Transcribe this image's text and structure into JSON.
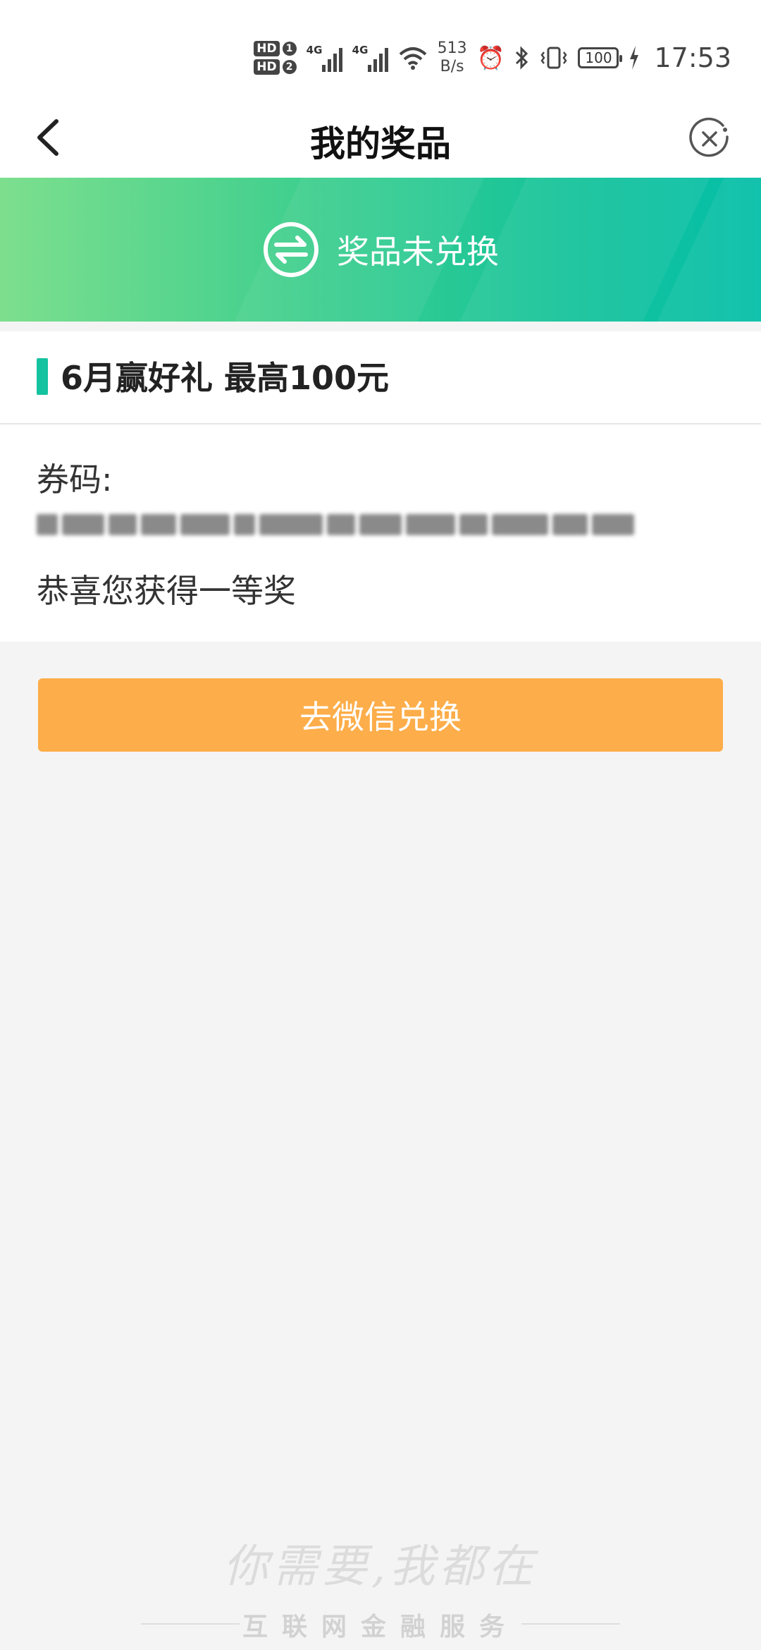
{
  "status_bar": {
    "sim1": "HD",
    "sim1_num": "1",
    "sim2": "HD",
    "sim2_num": "2",
    "net1": "4G",
    "net2": "4G",
    "speed_value": "513",
    "speed_unit": "B/s",
    "battery": "100",
    "time": "17:53",
    "icons": [
      "alarm-icon",
      "bluetooth-icon",
      "vibrate-icon",
      "charging-icon"
    ]
  },
  "header": {
    "title": "我的奖品",
    "back_icon": "back-arrow-icon",
    "close_icon": "close-circle-icon"
  },
  "banner": {
    "status_text": "奖品未兑换",
    "icon": "exchange-icon",
    "colors": [
      "#7ddf8e",
      "#05bfa8"
    ]
  },
  "prize": {
    "title": "6月赢好礼 最高100元",
    "code_label": "券码:",
    "message": "恭喜您获得一等奖"
  },
  "action": {
    "redeem_label": "去微信兑换",
    "color": "#fdad49"
  },
  "footer": {
    "slogan": "你需要,我都在",
    "tagline": "互联网金融服务"
  },
  "accent_color": "#15c3a0"
}
